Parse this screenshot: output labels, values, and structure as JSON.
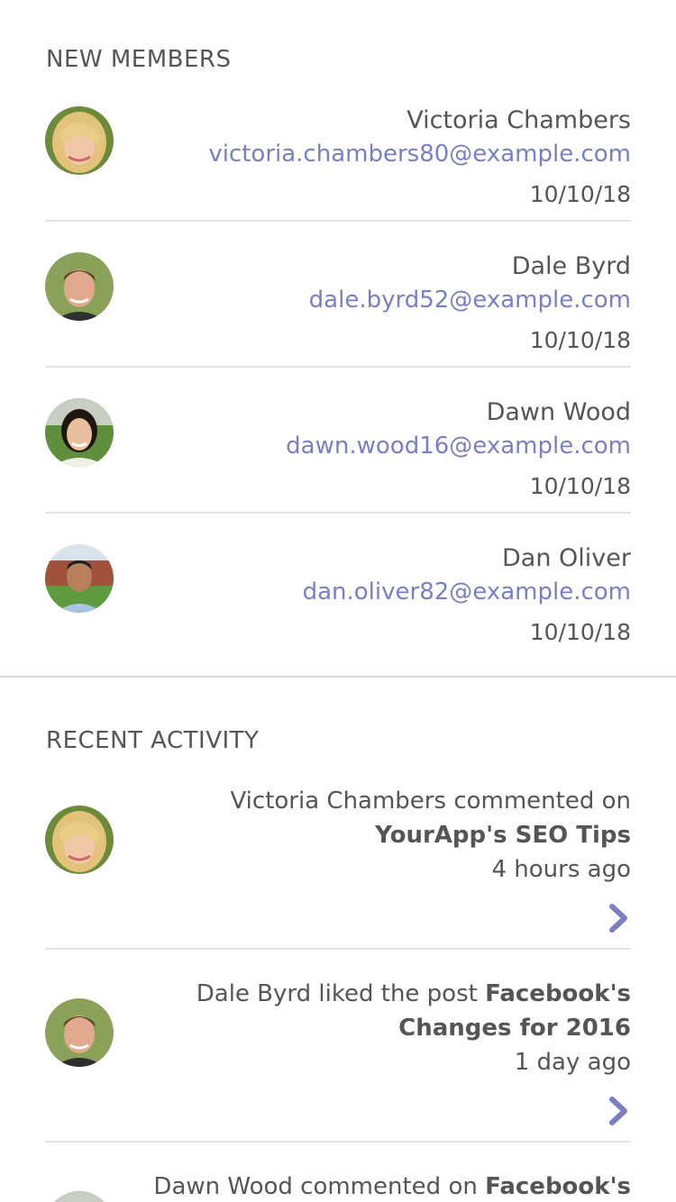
{
  "new_members": {
    "title": "NEW MEMBERS",
    "members": [
      {
        "name": "Victoria Chambers",
        "email": "victoria.chambers80@example.com",
        "date": "10/10/18"
      },
      {
        "name": "Dale Byrd",
        "email": "dale.byrd52@example.com",
        "date": "10/10/18"
      },
      {
        "name": "Dawn Wood",
        "email": "dawn.wood16@example.com",
        "date": "10/10/18"
      },
      {
        "name": "Dan Oliver",
        "email": "dan.oliver82@example.com",
        "date": "10/10/18"
      }
    ]
  },
  "recent_activity": {
    "title": "RECENT ACTIVITY",
    "items": [
      {
        "actor": "Victoria Chambers",
        "action": "commented on",
        "target": "YourApp's SEO Tips",
        "time": "4 hours ago",
        "link_icon": "chevron-right-icon"
      },
      {
        "actor": "Dale Byrd",
        "action": "liked the post",
        "target": "Facebook's Changes for 2016",
        "time": "1 day ago",
        "link_icon": "chevron-right-icon"
      },
      {
        "actor": "Dawn Wood",
        "action": "commented on",
        "target": "Facebook's"
      }
    ]
  },
  "colors": {
    "accent": "#7a7fc4",
    "text": "#555555",
    "divider": "#e4e4e4"
  }
}
